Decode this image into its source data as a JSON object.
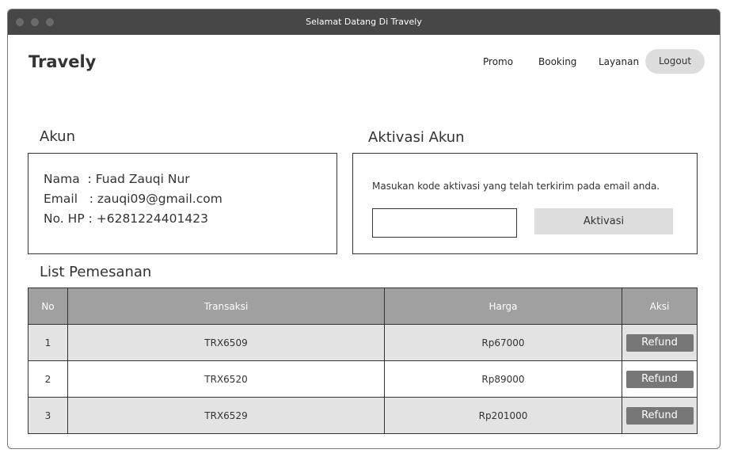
{
  "window": {
    "title": "Selamat Datang Di Travely"
  },
  "header": {
    "brand": "Travely",
    "nav": [
      "Promo",
      "Booking",
      "Layanan"
    ],
    "logout": "Logout"
  },
  "akun": {
    "title": "Akun",
    "nama": "Nama  : Fuad Zauqi Nur",
    "email": "Email   : zauqi09@gmail.com",
    "hp": "No. HP : +6281224401423"
  },
  "aktivasi": {
    "title": "Aktivasi Akun",
    "instruction": "Masukan kode aktivasi yang telah terkirim pada email anda.",
    "input_value": "",
    "button": "Aktivasi"
  },
  "pemesanan": {
    "title": "List Pemesanan",
    "columns": [
      "No",
      "Transaksi",
      "Harga",
      "Aksi"
    ],
    "rows": [
      {
        "no": "1",
        "transaksi": "TRX6509",
        "harga": "Rp67000",
        "aksi": "Refund"
      },
      {
        "no": "2",
        "transaksi": "TRX6520",
        "harga": "Rp89000",
        "aksi": "Refund"
      },
      {
        "no": "3",
        "transaksi": "TRX6529",
        "harga": "Rp201000",
        "aksi": "Refund"
      }
    ]
  }
}
